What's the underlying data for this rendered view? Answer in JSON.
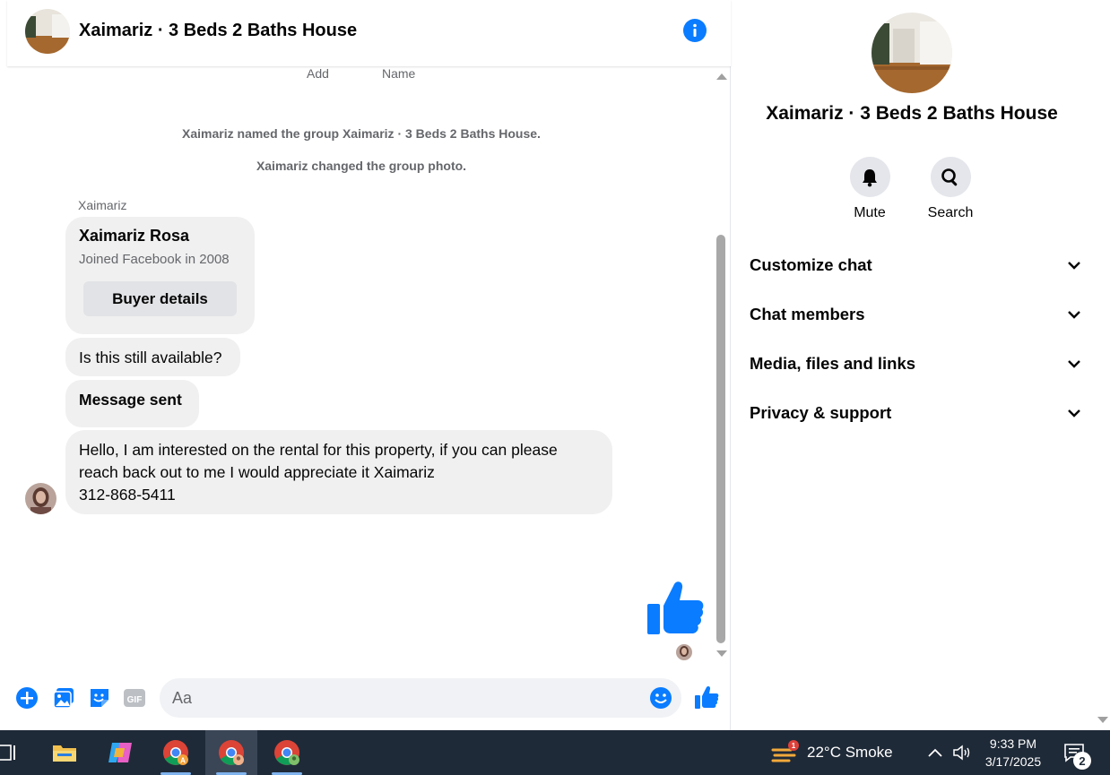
{
  "header": {
    "title": "Xaimariz · 3 Beds 2 Baths House",
    "info_icon": "info-icon"
  },
  "messages": {
    "cut_labels": [
      "Add",
      "Name"
    ],
    "system": [
      "Xaimariz named the group Xaimariz · 3 Beds 2 Baths House.",
      "Xaimariz changed the group photo."
    ],
    "sender": "Xaimariz",
    "profile_card": {
      "name": "Xaimariz Rosa",
      "subtitle": "Joined Facebook in 2008",
      "button": "Buyer details"
    },
    "bubbles": [
      "Is this still available?",
      "Message sent",
      "Hello, I am interested on the rental for this property, if you can please reach back out to me I would appreciate it Xaimariz",
      "312-868-5411"
    ]
  },
  "composer": {
    "placeholder": "Aa"
  },
  "side": {
    "title": "Xaimariz · 3 Beds 2 Baths House",
    "actions": [
      {
        "label": "Mute",
        "icon": "bell-icon"
      },
      {
        "label": "Search",
        "icon": "search-icon"
      }
    ],
    "sections": [
      "Customize chat",
      "Chat members",
      "Media, files and links",
      "Privacy & support"
    ]
  },
  "taskbar": {
    "weather_badge": "1",
    "weather": "22°C Smoke",
    "time": "9:33 PM",
    "date": "3/17/2025",
    "notif_count": "2"
  },
  "colors": {
    "accent": "#0a7cff",
    "bubble": "#f0f0f0",
    "muted_text": "#65676b",
    "taskbar": "#1f2a38"
  }
}
